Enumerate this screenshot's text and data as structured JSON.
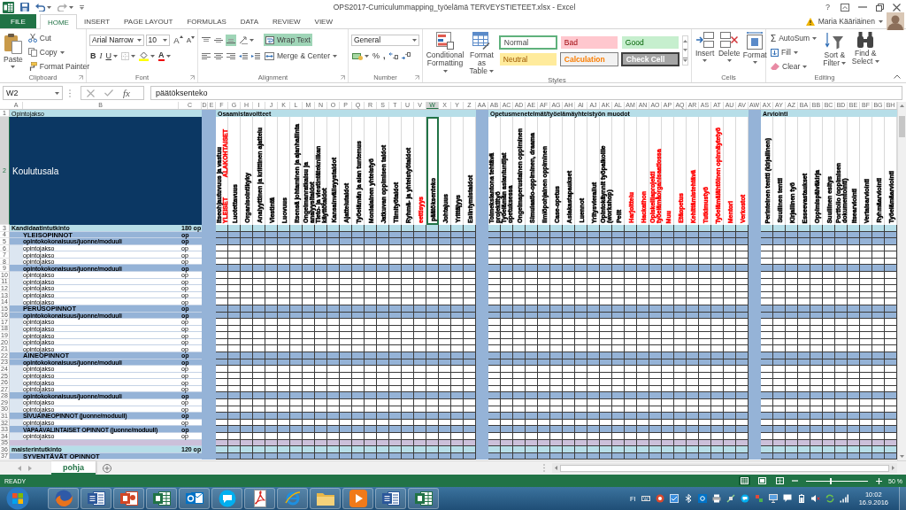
{
  "window": {
    "title": "OPS2017-Curriculummapping_työelämä TERVEYSTIETEET.xlsx - Excel",
    "help": "?"
  },
  "tabs": [
    {
      "label": "FILE",
      "kind": "file",
      "selected": false
    },
    {
      "label": "HOME",
      "kind": "tab",
      "selected": true
    },
    {
      "label": "INSERT",
      "kind": "tab",
      "selected": false
    },
    {
      "label": "PAGE LAYOUT",
      "kind": "tab",
      "selected": false
    },
    {
      "label": "FORMULAS",
      "kind": "tab",
      "selected": false
    },
    {
      "label": "DATA",
      "kind": "tab",
      "selected": false
    },
    {
      "label": "REVIEW",
      "kind": "tab",
      "selected": false
    },
    {
      "label": "VIEW",
      "kind": "tab",
      "selected": false
    }
  ],
  "account": {
    "name": "Maria Kääriäinen"
  },
  "ribbon": {
    "clipboard": {
      "label": "Clipboard",
      "paste": "Paste",
      "cut": "Cut",
      "copy": "Copy",
      "format_painter": "Format Painter"
    },
    "font": {
      "label": "Font",
      "font_name": "Arial Narrow",
      "font_size": "10",
      "grow": "A",
      "shrink": "A",
      "bold": "B",
      "italic": "I",
      "underline": "U",
      "font_color": "A"
    },
    "alignment": {
      "label": "Alignment",
      "vertical": [
        {
          "kind": "top",
          "selected": false
        },
        {
          "kind": "middle",
          "selected": false
        },
        {
          "kind": "bottom",
          "selected": true
        }
      ],
      "wrap_text": {
        "label": "Wrap Text",
        "on": true
      },
      "merge": "Merge & Center"
    },
    "number": {
      "label": "Number",
      "format": "General",
      "percent": "%",
      "comma": ","
    },
    "styles": {
      "label": "Styles",
      "conditional": "Conditional Formatting",
      "format_table": "Format as Table",
      "cell_styles": [
        {
          "label": "Normal",
          "kind": "normal",
          "selected": true
        },
        {
          "label": "Bad",
          "kind": "bad",
          "selected": false
        },
        {
          "label": "Good",
          "kind": "good",
          "selected": false
        },
        {
          "label": "Neutral",
          "kind": "neutral",
          "selected": false
        },
        {
          "label": "Calculation",
          "kind": "calculation",
          "selected": false
        },
        {
          "label": "Check Cell",
          "kind": "check",
          "selected": false
        }
      ]
    },
    "cells": {
      "label": "Cells",
      "buttons": [
        {
          "label": "Insert",
          "kind": "insert"
        },
        {
          "label": "Delete",
          "kind": "delete"
        },
        {
          "label": "Format",
          "kind": "format"
        }
      ]
    },
    "editing": {
      "label": "Editing",
      "autosum_symbol": "Σ",
      "autosum": "AutoSum",
      "fill": "Fill",
      "clear": "Clear",
      "sort": "Sort & Filter",
      "find": "Find & Select"
    }
  },
  "formula_bar": {
    "name_box": "W2",
    "fx": "fx",
    "formula": "päätöksenteko"
  },
  "sheet": {
    "columns": [
      {
        "label": "A",
        "kind": "data",
        "selected": false
      },
      {
        "label": "B",
        "kind": "data",
        "selected": false
      },
      {
        "label": "C",
        "kind": "data",
        "selected": false
      },
      {
        "label": "D",
        "kind": "separator",
        "selected": false
      },
      {
        "label": "E",
        "kind": "separator",
        "selected": false
      },
      {
        "label": "F",
        "kind": "data",
        "selected": false,
        "group_title": "Osaamistavoitteet",
        "heading": [
          {
            "text": "Itseohjautuvuus ja vastuu",
            "color": "#000000"
          },
          {
            "text": "YLEISET",
            "color": "#ff0000",
            "top_text": "ALAKOHTAISET"
          }
        ]
      },
      {
        "label": "G",
        "kind": "data",
        "selected": false,
        "heading": [
          {
            "text": "Luotettavuus",
            "color": "#000000"
          }
        ]
      },
      {
        "label": "H",
        "kind": "data",
        "selected": false,
        "heading": [
          {
            "text": "Organisointikyky",
            "color": "#000000"
          }
        ]
      },
      {
        "label": "I",
        "kind": "data",
        "selected": false,
        "heading": [
          {
            "text": "Analyyttinen ja kriittinen ajattelu",
            "color": "#000000"
          }
        ]
      },
      {
        "label": "J",
        "kind": "data",
        "selected": false,
        "heading": [
          {
            "text": "Viestintä",
            "color": "#000000"
          }
        ]
      },
      {
        "label": "K",
        "kind": "data",
        "selected": false,
        "heading": [
          {
            "text": "Luovuus",
            "color": "#000000"
          }
        ]
      },
      {
        "label": "L",
        "kind": "data",
        "selected": false,
        "heading": [
          {
            "text": "Itsensä johtaminen ja ajanhallinta",
            "color": "#000000"
          }
        ]
      },
      {
        "label": "M",
        "kind": "data",
        "selected": false,
        "heading": [
          {
            "text": "Ongelmanratkaisu ja analyysitaidot",
            "color": "#000000"
          }
        ]
      },
      {
        "label": "N",
        "kind": "data",
        "selected": false,
        "heading": [
          {
            "text": "Tieto- ja viestintätekniikan käyttötaidot",
            "color": "#000000"
          }
        ]
      },
      {
        "label": "O",
        "kind": "data",
        "selected": false,
        "heading": [
          {
            "text": "Kansainvälisyystaidot",
            "color": "#000000"
          }
        ]
      },
      {
        "label": "P",
        "kind": "data",
        "selected": false,
        "heading": [
          {
            "text": "Ajattelutaidot",
            "color": "#000000"
          }
        ]
      },
      {
        "label": "Q",
        "kind": "data",
        "selected": false,
        "heading": [
          {
            "text": "Työelämän ja alan tuntemus",
            "color": "#000000"
          }
        ]
      },
      {
        "label": "R",
        "kind": "data",
        "selected": false,
        "heading": [
          {
            "text": "Monialainen yhteistyö",
            "color": "#000000"
          }
        ]
      },
      {
        "label": "S",
        "kind": "data",
        "selected": false,
        "heading": [
          {
            "text": "Jatkuvan oppimisen taidot",
            "color": "#000000"
          }
        ]
      },
      {
        "label": "T",
        "kind": "data",
        "selected": false,
        "heading": [
          {
            "text": "Tiimityötaidot",
            "color": "#000000"
          }
        ]
      },
      {
        "label": "U",
        "kind": "data",
        "selected": false,
        "heading": [
          {
            "text": "Ryhmä- ja yhteistyötaidot",
            "color": "#000000"
          }
        ]
      },
      {
        "label": "V",
        "kind": "data",
        "selected": false,
        "heading": [
          {
            "text": "eettisyys",
            "color": "#ff0000"
          }
        ]
      },
      {
        "label": "W",
        "kind": "data",
        "selected": true,
        "heading": [
          {
            "text": "päätöksenteko",
            "color": "#000000"
          }
        ]
      },
      {
        "label": "X",
        "kind": "data",
        "selected": false,
        "heading": [
          {
            "text": "Johtajuus",
            "color": "#000000"
          }
        ]
      },
      {
        "label": "Y",
        "kind": "data",
        "selected": false,
        "heading": [
          {
            "text": "Yrittäjyys",
            "color": "#000000"
          }
        ]
      },
      {
        "label": "Z",
        "kind": "data",
        "selected": false,
        "heading": [
          {
            "text": "Esiintymistaidot",
            "color": "#000000"
          }
        ]
      },
      {
        "label": "AA",
        "kind": "separator",
        "selected": false
      },
      {
        "label": "AB",
        "kind": "data",
        "selected": false,
        "group_title": "Opetusmenetelmät/työelämäyhteistyön muodot",
        "heading": [
          {
            "text": "Toimeksiantona tehtävä projektityö",
            "color": "#000000"
          }
        ]
      },
      {
        "label": "AC",
        "kind": "data",
        "selected": false,
        "heading": [
          {
            "text": "Työelämän asiantuntijat opetuksessa",
            "color": "#000000"
          }
        ]
      },
      {
        "label": "AD",
        "kind": "data",
        "selected": false,
        "heading": [
          {
            "text": "Ongelmaperustainen oppiminen",
            "color": "#000000"
          }
        ]
      },
      {
        "label": "AE",
        "kind": "data",
        "selected": false,
        "heading": [
          {
            "text": "Simulaatio-oppiminen, draama",
            "color": "#000000"
          }
        ]
      },
      {
        "label": "AF",
        "kind": "data",
        "selected": false,
        "heading": [
          {
            "text": "Ilmiöpohjainen oppiminen",
            "color": "#000000"
          }
        ]
      },
      {
        "label": "AG",
        "kind": "data",
        "selected": false,
        "heading": [
          {
            "text": "Case-opetus",
            "color": "#000000"
          }
        ]
      },
      {
        "label": "AH",
        "kind": "data",
        "selected": false,
        "heading": [
          {
            "text": "Asiakastapaukset",
            "color": "#000000"
          }
        ]
      },
      {
        "label": "AI",
        "kind": "data",
        "selected": false,
        "heading": [
          {
            "text": "Luennot",
            "color": "#000000"
          }
        ]
      },
      {
        "label": "AJ",
        "kind": "data",
        "selected": false,
        "heading": [
          {
            "text": "Yritysvierailut",
            "color": "#000000"
          }
        ]
      },
      {
        "label": "AK",
        "kind": "data",
        "selected": false,
        "heading": [
          {
            "text": "Opintokäynnit työpaikoille (workshop)",
            "color": "#000000"
          }
        ]
      },
      {
        "label": "AL",
        "kind": "data",
        "selected": false,
        "heading": [
          {
            "text": "Pelit",
            "color": "#000000"
          }
        ]
      },
      {
        "label": "AM",
        "kind": "data",
        "selected": false,
        "heading": [
          {
            "text": "Harjoittelu",
            "color": "#ff0000"
          }
        ]
      },
      {
        "label": "AN",
        "kind": "data",
        "selected": false,
        "heading": [
          {
            "text": "Hackathon",
            "color": "#ff0000"
          }
        ]
      },
      {
        "label": "AO",
        "kind": "data",
        "selected": false,
        "heading": [
          {
            "text": "Opiskelijaprojekti työelämäorganisaatiossa",
            "color": "#ff0000"
          }
        ]
      },
      {
        "label": "AP",
        "kind": "data",
        "selected": false,
        "heading": [
          {
            "text": "Muu",
            "color": "#ff0000"
          }
        ]
      },
      {
        "label": "AQ",
        "kind": "data",
        "selected": false,
        "heading": [
          {
            "text": "Etäopetus",
            "color": "#ff0000"
          }
        ]
      },
      {
        "label": "AR",
        "kind": "data",
        "selected": false,
        "heading": [
          {
            "text": "Kehittämistehtävä",
            "color": "#ff0000"
          }
        ]
      },
      {
        "label": "AS",
        "kind": "data",
        "selected": false,
        "heading": [
          {
            "text": "Tutkimustyö",
            "color": "#ff0000"
          }
        ]
      },
      {
        "label": "AT",
        "kind": "data",
        "selected": false,
        "heading": [
          {
            "text": "Työelämälähtöinen opinnäytetyö",
            "color": "#ff0000"
          }
        ]
      },
      {
        "label": "AU",
        "kind": "data",
        "selected": false,
        "heading": [
          {
            "text": "Mentori",
            "color": "#ff0000"
          }
        ]
      },
      {
        "label": "AV",
        "kind": "data",
        "selected": false,
        "heading": [
          {
            "text": "Verkostot",
            "color": "#ff0000"
          }
        ]
      },
      {
        "label": "AW",
        "kind": "separator",
        "selected": false
      },
      {
        "label": "AX",
        "kind": "data",
        "selected": false,
        "group_title": "Arviointi",
        "heading": [
          {
            "text": "Perinteinen tentti (kirjallinen)",
            "color": "#000000"
          }
        ]
      },
      {
        "label": "AY",
        "kind": "data",
        "selected": false,
        "heading": [
          {
            "text": "Suullinen tentti",
            "color": "#000000"
          }
        ]
      },
      {
        "label": "AZ",
        "kind": "data",
        "selected": false,
        "heading": [
          {
            "text": "Kirjallinen työ",
            "color": "#000000"
          }
        ]
      },
      {
        "label": "BA",
        "kind": "data",
        "selected": false,
        "heading": [
          {
            "text": "Esseevastaukset",
            "color": "#000000"
          }
        ]
      },
      {
        "label": "BB",
        "kind": "data",
        "selected": false,
        "heading": [
          {
            "text": "Oppimispäiväkirja",
            "color": "#000000"
          }
        ]
      },
      {
        "label": "BC",
        "kind": "data",
        "selected": false,
        "heading": [
          {
            "text": "Suullinen esitys",
            "color": "#000000"
          }
        ]
      },
      {
        "label": "BD",
        "kind": "data",
        "selected": false,
        "heading": [
          {
            "text": "Portfolio (oppimisen dokumentointi)",
            "color": "#000000"
          }
        ]
      },
      {
        "label": "BE",
        "kind": "data",
        "selected": false,
        "heading": [
          {
            "text": "Itsearviointi",
            "color": "#000000"
          }
        ]
      },
      {
        "label": "BF",
        "kind": "data",
        "selected": false,
        "heading": [
          {
            "text": "Vertaisarviointi",
            "color": "#000000"
          }
        ]
      },
      {
        "label": "BG",
        "kind": "data",
        "selected": false,
        "heading": [
          {
            "text": "Ryhmäarviointi",
            "color": "#000000"
          }
        ]
      },
      {
        "label": "BH",
        "kind": "data",
        "selected": false,
        "heading": [
          {
            "text": "Työelämäarviointi",
            "color": "#000000"
          }
        ]
      }
    ],
    "rows": [
      {
        "number": "1",
        "kind": "group_header",
        "selected": false,
        "title": "Opintojakso"
      },
      {
        "number": "2",
        "kind": "headings",
        "selected": true,
        "title": "Koulutusala"
      },
      {
        "number": "3",
        "kind": "degree",
        "selected": false,
        "title": "Kandidaatintutkinto",
        "credits": "180 op"
      },
      {
        "number": "4",
        "kind": "section",
        "selected": false,
        "title": "YLEISOPINNOT",
        "credits": "op"
      },
      {
        "number": "5",
        "kind": "module",
        "selected": false,
        "title": "opintokokonaisuus/juonne/moduuli",
        "credits": "op"
      },
      {
        "number": "6",
        "kind": "course",
        "selected": false,
        "title": "opintojakso",
        "credits": "op"
      },
      {
        "number": "7",
        "kind": "course",
        "selected": false,
        "title": "opintojakso",
        "credits": "op"
      },
      {
        "number": "8",
        "kind": "course",
        "selected": false,
        "title": "opintojakso",
        "credits": "op"
      },
      {
        "number": "9",
        "kind": "module",
        "selected": false,
        "title": "opintokokonaisuus/juonne/moduuli",
        "credits": "op"
      },
      {
        "number": "10",
        "kind": "course",
        "selected": false,
        "title": "opintojakso",
        "credits": "op"
      },
      {
        "number": "11",
        "kind": "course",
        "selected": false,
        "title": "opintojakso",
        "credits": "op"
      },
      {
        "number": "12",
        "kind": "course",
        "selected": false,
        "title": "opintojakso",
        "credits": "op"
      },
      {
        "number": "13",
        "kind": "course",
        "selected": false,
        "title": "opintojakso",
        "credits": "op"
      },
      {
        "number": "14",
        "kind": "course",
        "selected": false,
        "title": "opintojakso",
        "credits": "op"
      },
      {
        "number": "15",
        "kind": "section",
        "selected": false,
        "title": "PERUSOPINNOT",
        "credits": "op"
      },
      {
        "number": "16",
        "kind": "module",
        "selected": false,
        "title": "opintokokonaisuus/juonne/moduuli",
        "credits": "op"
      },
      {
        "number": "17",
        "kind": "course",
        "selected": false,
        "title": "opintojakso",
        "credits": "op"
      },
      {
        "number": "18",
        "kind": "course",
        "selected": false,
        "title": "opintojakso",
        "credits": "op"
      },
      {
        "number": "19",
        "kind": "course",
        "selected": false,
        "title": "opintojakso",
        "credits": "op"
      },
      {
        "number": "20",
        "kind": "course",
        "selected": false,
        "title": "opintojakso",
        "credits": "op"
      },
      {
        "number": "21",
        "kind": "course",
        "selected": false,
        "title": "opintojakso",
        "credits": "op"
      },
      {
        "number": "22",
        "kind": "section",
        "selected": false,
        "title": "AINEOPINNOT",
        "credits": "op"
      },
      {
        "number": "23",
        "kind": "module",
        "selected": false,
        "title": "opintokokonaisuus/juonne/moduuli",
        "credits": "op"
      },
      {
        "number": "24",
        "kind": "course",
        "selected": false,
        "title": "opintojakso",
        "credits": "op"
      },
      {
        "number": "25",
        "kind": "course",
        "selected": false,
        "title": "opintojakso",
        "credits": "op"
      },
      {
        "number": "26",
        "kind": "course",
        "selected": false,
        "title": "opintojakso",
        "credits": "op"
      },
      {
        "number": "27",
        "kind": "course",
        "selected": false,
        "title": "opintojakso",
        "credits": "op"
      },
      {
        "number": "28",
        "kind": "module",
        "selected": false,
        "title": "opintokokonaisuus/juonne/moduuli",
        "credits": "op"
      },
      {
        "number": "29",
        "kind": "course",
        "selected": false,
        "title": "opintojakso",
        "credits": "op"
      },
      {
        "number": "30",
        "kind": "course",
        "selected": false,
        "title": "opintojakso",
        "credits": "op"
      },
      {
        "number": "31",
        "kind": "module",
        "selected": false,
        "title": "SIVUAINEOPINNOT (juonne/moduuli)",
        "credits": "op"
      },
      {
        "number": "32",
        "kind": "course",
        "selected": false,
        "title": "opintojakso",
        "credits": "op"
      },
      {
        "number": "33",
        "kind": "module",
        "selected": false,
        "title": "VAPAAVALINTAISET OPINNOT (juonne/moduuli)",
        "credits": "op"
      },
      {
        "number": "34",
        "kind": "course",
        "selected": false,
        "title": "opintojakso",
        "credits": "op"
      },
      {
        "number": "35",
        "kind": "spacer",
        "selected": false
      },
      {
        "number": "36",
        "kind": "degree",
        "selected": false,
        "title": "maisterintutkinto",
        "credits": "120 op"
      },
      {
        "number": "37",
        "kind": "section",
        "selected": false,
        "title": "SYVENTÄVÄT OPINNOT"
      }
    ]
  },
  "sheet_tabs": [
    {
      "label": "pohja",
      "selected": true
    }
  ],
  "status_bar": {
    "mode": "READY",
    "views": [
      {
        "kind": "normal",
        "selected": true
      },
      {
        "kind": "page_layout",
        "selected": false
      },
      {
        "kind": "page_break",
        "selected": false
      }
    ],
    "zoom": {
      "level": 0.4,
      "reading": "50 %"
    }
  },
  "taskbar": {
    "apps": [
      {
        "kind": "globe"
      },
      {
        "kind": "document"
      },
      {
        "kind": "presentation"
      },
      {
        "kind": "spreadsheet"
      },
      {
        "kind": "mail"
      },
      {
        "kind": "chat"
      },
      {
        "kind": "pdf"
      },
      {
        "kind": "browser"
      },
      {
        "kind": "folder"
      },
      {
        "kind": "media"
      },
      {
        "kind": "document"
      },
      {
        "kind": "spreadsheet"
      }
    ],
    "language": "FI",
    "time": "10:02",
    "date": "16.9.2016"
  }
}
